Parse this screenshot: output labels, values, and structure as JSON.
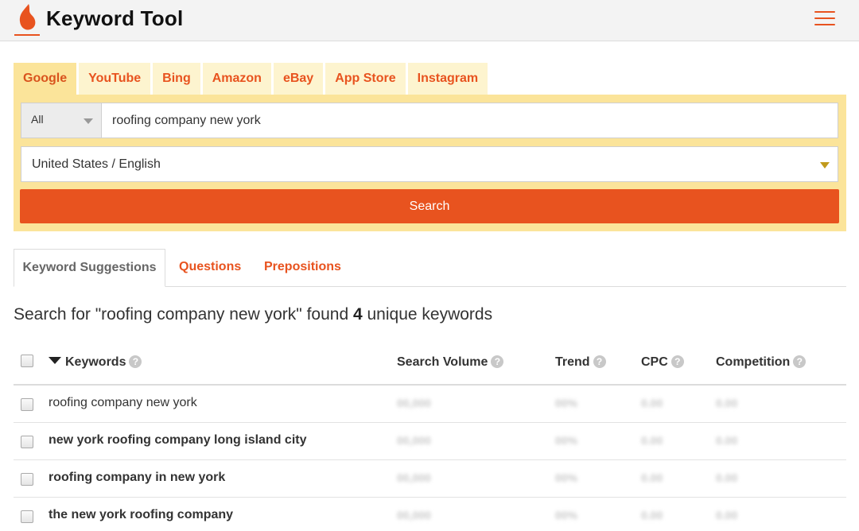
{
  "header": {
    "title": "Keyword Tool",
    "brand_color": "#e8531f"
  },
  "engine_tabs": [
    "Google",
    "YouTube",
    "Bing",
    "Amazon",
    "eBay",
    "App Store",
    "Instagram"
  ],
  "search": {
    "type_value": "All",
    "query": "roofing company new york",
    "locale": "United States / English",
    "button_label": "Search"
  },
  "result_tabs": [
    "Keyword Suggestions",
    "Questions",
    "Prepositions"
  ],
  "summary": {
    "prefix": "Search for \"roofing company new york\" found ",
    "count": "4",
    "suffix": " unique keywords"
  },
  "table": {
    "columns": [
      "Keywords",
      "Search Volume",
      "Trend",
      "CPC",
      "Competition"
    ],
    "help_glyph": "?",
    "placeholder": {
      "volume": "00,000",
      "trend": "00%",
      "cpc": "0.00",
      "competition": "0.00"
    },
    "rows": [
      {
        "keyword": "roofing company new york"
      },
      {
        "keyword": "new york roofing company long island city"
      },
      {
        "keyword": "roofing company in new york"
      },
      {
        "keyword": "the new york roofing company"
      }
    ]
  }
}
